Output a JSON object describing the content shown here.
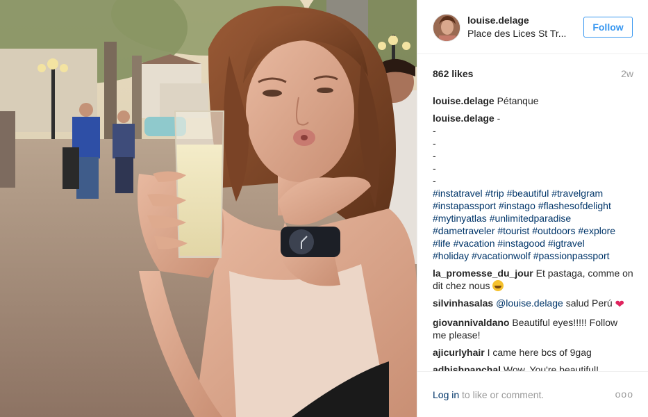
{
  "post": {
    "username": "louise.delage",
    "location": "Place des Lices St Tr...",
    "follow_label": "Follow",
    "likes": "862 likes",
    "time_ago": "2w"
  },
  "caption": {
    "username": "louise.delage",
    "text": "Pétanque"
  },
  "second_comment": {
    "username": "louise.delage",
    "first_line": "-",
    "dash_lines": [
      "-",
      "-",
      "-",
      "-",
      "-"
    ],
    "hashtags": [
      "#instatravel",
      "#trip",
      "#beautiful",
      "#travelgram",
      "#instapassport",
      "#instago",
      "#flashesofdelight",
      "#mytinyatlas",
      "#unlimitedparadise",
      "#dametraveler",
      "#tourist",
      "#outdoors",
      "#explore",
      "#life",
      "#vacation",
      "#instagood",
      "#igtravel",
      "#holiday",
      "#vacationwolf",
      "#passionpassport"
    ]
  },
  "comments": [
    {
      "username": "la_promesse_du_jour",
      "text": "Et pastaga, comme on dit chez nous",
      "emoji": "laughing-emoji"
    },
    {
      "username": "silvinhasalas",
      "mention": "@louise.delage",
      "text": "salud Perú",
      "emoji": "heart-emoji"
    },
    {
      "username": "giovannivaldano",
      "text": "Beautiful eyes!!!!! Follow me please!"
    },
    {
      "username": "ajicurlyhair",
      "text": "I came here bcs of 9gag"
    },
    {
      "username": "adhishpanchal",
      "text": "Wow. You're beautiful!"
    }
  ],
  "footer": {
    "login_link": "Log in",
    "login_rest": "to like or comment.",
    "more_label": "ooo"
  },
  "colors": {
    "link_blue": "#003569",
    "follow_blue": "#3897f0",
    "muted": "#999999",
    "text": "#262626",
    "divider": "#efefef"
  }
}
